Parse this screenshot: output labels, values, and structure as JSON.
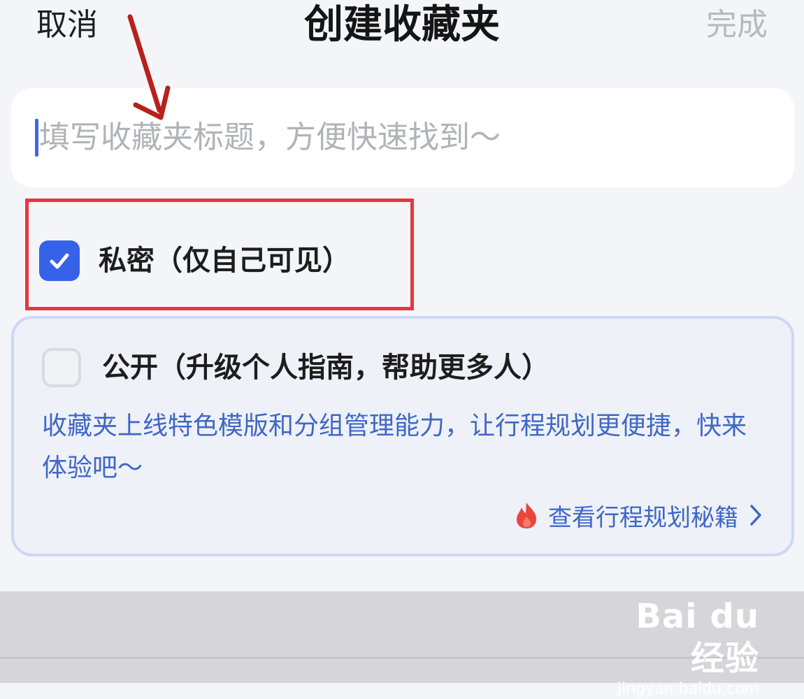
{
  "header": {
    "cancel_label": "取消",
    "title": "创建收藏夹",
    "done_label": "完成"
  },
  "title_input": {
    "placeholder": "填写收藏夹标题，方便快速找到～",
    "value": ""
  },
  "visibility_options": {
    "private": {
      "label": "私密（仅自己可见）",
      "checked": true
    },
    "public": {
      "label": "公开（升级个人指南，帮助更多人）",
      "checked": false,
      "promo_text": "收藏夹上线特色模版和分组管理能力，让行程规划更便捷，快来体验吧～",
      "guide_link_label": "查看行程规划秘籍"
    }
  },
  "watermark": {
    "logo": "Bai du 经验",
    "url": "jingyan.baidu.com"
  },
  "colors": {
    "accent_blue": "#3562e8",
    "link_blue": "#3f67c6",
    "highlight_red": "#e6383c",
    "annotation_arrow": "#b8201c"
  },
  "icons": {
    "checked": "checkmark-icon",
    "guide": "fire-icon",
    "chevron": "chevron-right-icon"
  }
}
